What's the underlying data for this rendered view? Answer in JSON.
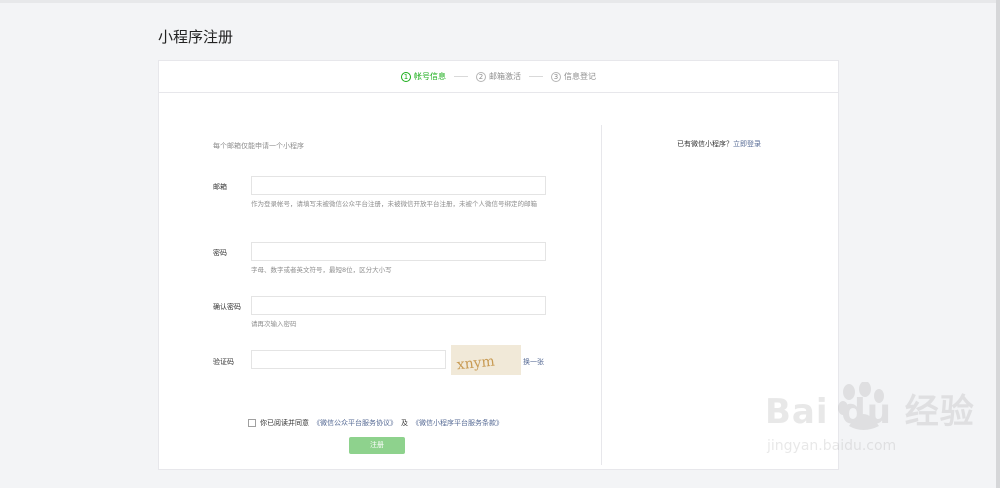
{
  "page": {
    "title": "小程序注册"
  },
  "steps": [
    {
      "num": "1",
      "label": "帐号信息",
      "active": true
    },
    {
      "num": "2",
      "label": "邮箱激活",
      "active": false
    },
    {
      "num": "3",
      "label": "信息登记",
      "active": false
    }
  ],
  "form": {
    "tip": "每个邮箱仅能申请一个小程序",
    "email": {
      "label": "邮箱",
      "value": "",
      "help": "作为登录帐号，请填写未被微信公众平台注册，未被微信开放平台注册，未被个人微信号绑定的邮箱"
    },
    "password": {
      "label": "密码",
      "value": "",
      "help": "字母、数字或者英文符号，最短8位，区分大小写"
    },
    "confirm_password": {
      "label": "确认密码",
      "value": "",
      "help": "请再次输入密码"
    },
    "captcha": {
      "label": "验证码",
      "value": "",
      "image_text": "xnym",
      "refresh_label": "换一张"
    },
    "agreement": {
      "prefix": "你已阅读并同意",
      "link1": "《微信公众平台服务协议》",
      "joiner": "及",
      "link2": "《微信小程序平台服务条款》",
      "checked": false
    },
    "submit_label": "注册"
  },
  "sidebar": {
    "text": "已有微信小程序？",
    "login_link": "立即登录"
  },
  "watermark": {
    "brand": "Bai  du 经验",
    "url": "jingyan.baidu.com"
  },
  "colors": {
    "accent_green": "#1aad19",
    "link_blue": "#576b95",
    "button_disabled": "#8ed28d"
  }
}
